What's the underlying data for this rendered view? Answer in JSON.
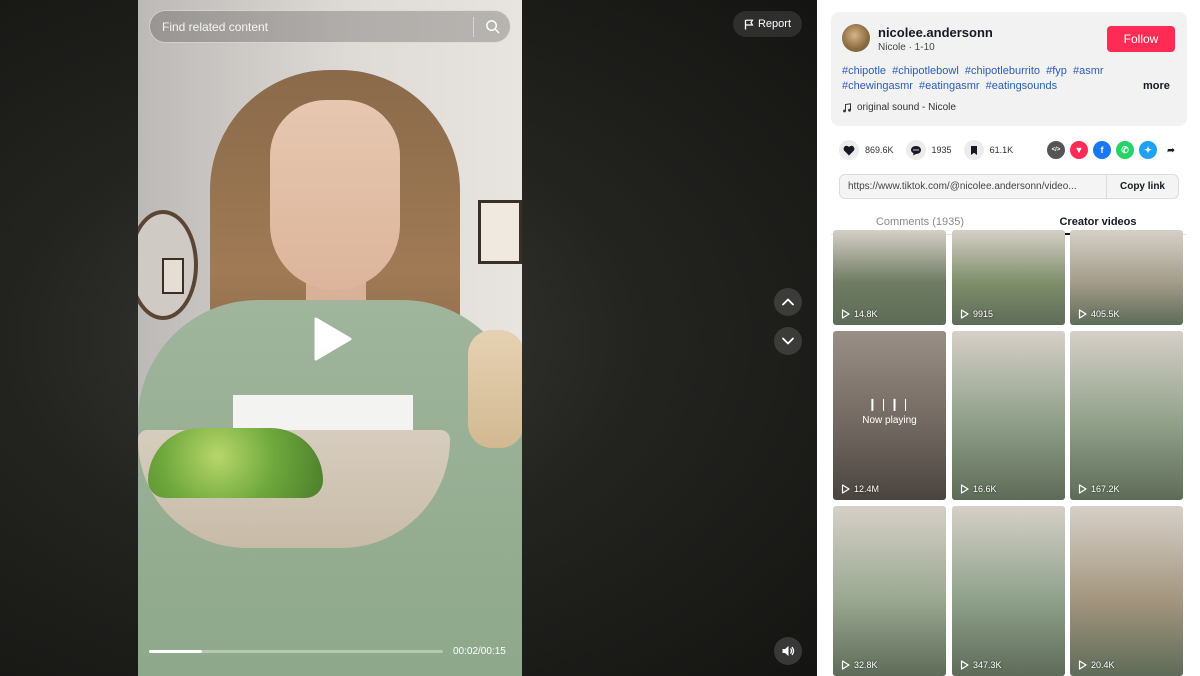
{
  "search": {
    "placeholder": "Find related content"
  },
  "report": {
    "label": "Report"
  },
  "player": {
    "time": "00:02/00:15",
    "progress_fraction": 0.18
  },
  "author": {
    "username": "nicolee.andersonn",
    "subtitle": "Nicole · 1-10",
    "follow_label": "Follow"
  },
  "caption": {
    "hashtags": [
      "#chipotle",
      "#chipotlebowl",
      "#chipotleburrito",
      "#fyp",
      "#asmr",
      "#chewingasmr",
      "#eatingasmr",
      "#eatingsounds"
    ],
    "more_label": "more"
  },
  "sound": {
    "label": "original sound - Nicole"
  },
  "stats": {
    "likes": "869.6K",
    "comments": "1935",
    "saves": "61.1K"
  },
  "share": {
    "icons": [
      "embed-icon",
      "tiktok-friends-icon",
      "facebook-icon",
      "whatsapp-icon",
      "twitter-icon",
      "share-arrow-icon"
    ],
    "link": "https://www.tiktok.com/@nicolee.andersonn/video...",
    "copy_label": "Copy link"
  },
  "tabs": {
    "comments": "Comments (1935)",
    "creator_videos": "Creator videos"
  },
  "creator_videos": [
    {
      "views": "14.8K",
      "tone": "#6f7c62"
    },
    {
      "views": "9915",
      "tone": "#7f8f6a"
    },
    {
      "views": "405.5K",
      "tone": "#a39c8a"
    },
    {
      "views": "12.4M",
      "tone": "#8b7e74",
      "now_playing": true,
      "now_playing_label": "Now playing"
    },
    {
      "views": "16.6K",
      "tone": "#8e9e88"
    },
    {
      "views": "167.2K",
      "tone": "#90a089"
    },
    {
      "views": "32.8K",
      "tone": "#9aa891"
    },
    {
      "views": "347.3K",
      "tone": "#8fa18b"
    },
    {
      "views": "20.4K",
      "tone": "#a4967f"
    }
  ],
  "colors": {
    "follow": "#fe2c55",
    "hashtag": "#2b5db9",
    "facebook": "#1877f2",
    "whatsapp": "#25d366",
    "twitter": "#1da1f2",
    "friends": "#fe2c55",
    "embed": "#555555"
  }
}
